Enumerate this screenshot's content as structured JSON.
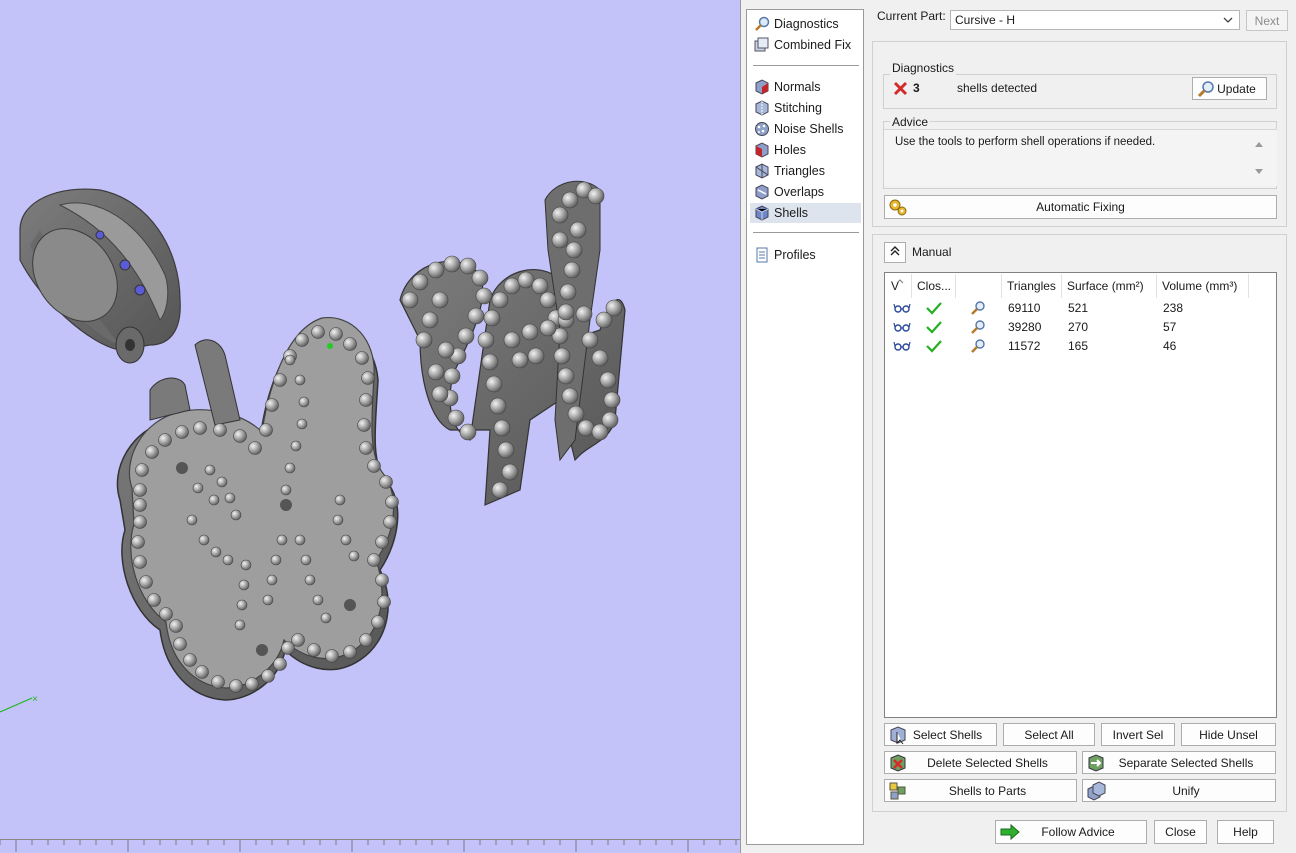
{
  "nav": {
    "items_top": [
      {
        "label": "Diagnostics",
        "icon": "magnifier-icon"
      },
      {
        "label": "Combined Fix",
        "icon": "combined-fix-icon"
      }
    ],
    "items_mid": [
      {
        "label": "Normals",
        "icon": "normals-icon"
      },
      {
        "label": "Stitching",
        "icon": "stitching-icon"
      },
      {
        "label": "Noise Shells",
        "icon": "noise-shells-icon"
      },
      {
        "label": "Holes",
        "icon": "holes-icon"
      },
      {
        "label": "Triangles",
        "icon": "triangles-icon"
      },
      {
        "label": "Overlaps",
        "icon": "overlaps-icon"
      },
      {
        "label": "Shells",
        "icon": "shells-icon",
        "selected": true
      }
    ],
    "items_bottom": [
      {
        "label": "Profiles",
        "icon": "profiles-icon"
      }
    ]
  },
  "current_part": {
    "label": "Current Part:",
    "value": "Cursive - H",
    "next_label": "Next"
  },
  "diagnostics": {
    "title": "Diagnostics",
    "count": "3",
    "status_text": "shells detected",
    "update_label": "Update"
  },
  "advice": {
    "title": "Advice",
    "text": "Use the tools to perform shell operations if needed."
  },
  "automatic_fixing_label": "Automatic Fixing",
  "manual": {
    "label": "Manual",
    "columns": [
      "V",
      "Clos...",
      "",
      "Triangles",
      "Surface (mm²)",
      "Volume (mm³)"
    ],
    "rows": [
      {
        "triangles": "69110",
        "surface": "521",
        "volume": "238"
      },
      {
        "triangles": "39280",
        "surface": "270",
        "volume": "57"
      },
      {
        "triangles": "11572",
        "surface": "165",
        "volume": "46"
      }
    ]
  },
  "buttons": {
    "select_shells": "Select Shells",
    "select_all": "Select All",
    "invert_sel": "Invert Sel",
    "hide_unsel": "Hide Unsel",
    "delete_selected": "Delete Selected Shells",
    "separate_selected": "Separate Selected Shells",
    "shells_to_parts": "Shells to Parts",
    "unify": "Unify",
    "follow_advice": "Follow Advice",
    "close": "Close",
    "help": "Help"
  },
  "colors": {
    "viewport_bg": "#c3c3f9",
    "model_gray": "#8e8e8e",
    "check_green": "#22b022",
    "error_red": "#d42a2a"
  }
}
